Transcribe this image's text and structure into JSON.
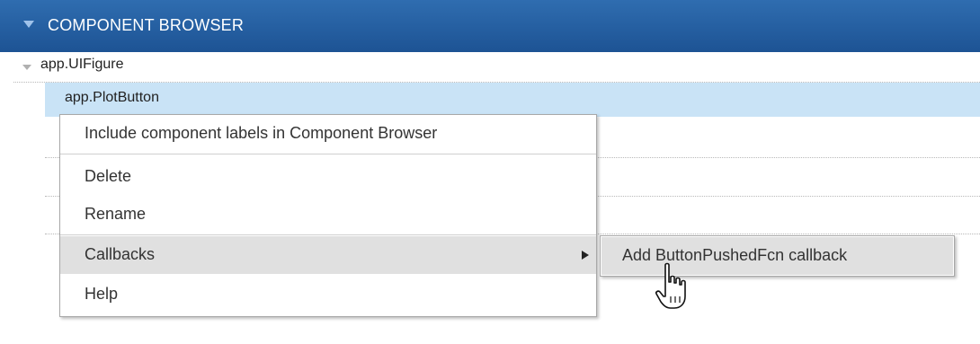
{
  "panel": {
    "title": "COMPONENT BROWSER",
    "header_color": "#1d5394",
    "collapse_icon": "triangle-down-icon"
  },
  "tree": {
    "root": {
      "label": "app.UIFigure",
      "toggle_icon": "triangle-down-icon",
      "expanded": true
    },
    "items": [
      {
        "label": "app.PlotButton",
        "selected": true
      }
    ],
    "selection_color": "#c9e3f6"
  },
  "context_menu": {
    "items": [
      {
        "label": "Include component labels in Component Browser"
      },
      {
        "label": "Delete"
      },
      {
        "label": "Rename"
      },
      {
        "label": "Callbacks",
        "has_submenu": true,
        "highlighted": true
      },
      {
        "label": "Help"
      }
    ],
    "highlight_color": "#e0e0e0"
  },
  "submenu": {
    "items": [
      {
        "label": "Add ButtonPushedFcn callback",
        "highlighted": true
      }
    ]
  },
  "cursor": {
    "icon": "hand-pointer-icon"
  }
}
